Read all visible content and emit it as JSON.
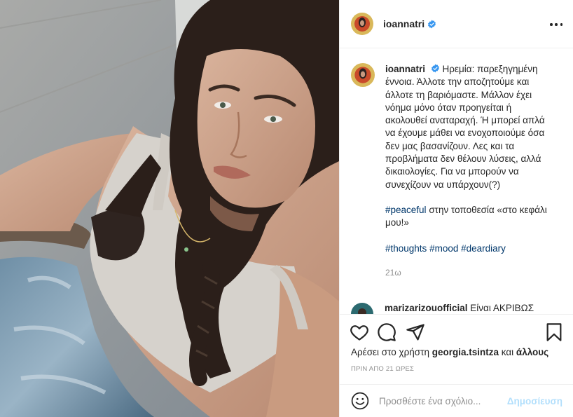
{
  "post": {
    "username": "ioannatri",
    "verified": true,
    "caption": {
      "text": "Ηρεμία: παρεξηγημένη έννοια. Άλλοτε την αποζητούμε και άλλοτε τη βαριόμαστε. Μάλλον έχει νόημα μόνο όταν προηγείται ή ακολουθεί αναταραχή. Ή μπορεί απλά να έχουμε μάθει να ενοχοποιούμε όσα δεν μας βασανίζουν. Λες και τα προβλήματα δεν θέλουν λύσεις, αλλά δικαιολογίες. Για να μπορούν να συνεχίζουν να υπάρχουν(?)",
      "tag_peaceful": "#peaceful",
      "location_text": " στην τοποθεσία «στο κεφάλι μου!»",
      "tags": [
        "#thoughts",
        "#mood",
        "#deardiary"
      ],
      "time_ago": "21ω"
    },
    "reply": {
      "username": "marizarizouofficial",
      "text": "Είναι ΑΚΡΙΒΩΣ"
    },
    "likes": {
      "prefix": "Αρέσει στο χρήστη ",
      "user": "georgia.tsintza",
      "middle": " και ",
      "others": "άλλους"
    },
    "date": "ΠΡΙΝ ΑΠΟ 21 ΩΡΕΣ",
    "add_comment": {
      "placeholder": "Προσθέστε ένα σχόλιο...",
      "post_label": "Δημοσίευση"
    },
    "icons": {
      "like": "heart-icon",
      "comment": "comment-icon",
      "share": "paper-plane-icon",
      "save": "bookmark-icon",
      "more": "more-options-icon",
      "emoji": "emoji-icon",
      "verified": "verified-badge-icon"
    },
    "colors": {
      "link": "#00376b",
      "verified": "#3897f0",
      "muted": "#8e8e8e",
      "post_button": "#b2dffc"
    }
  }
}
